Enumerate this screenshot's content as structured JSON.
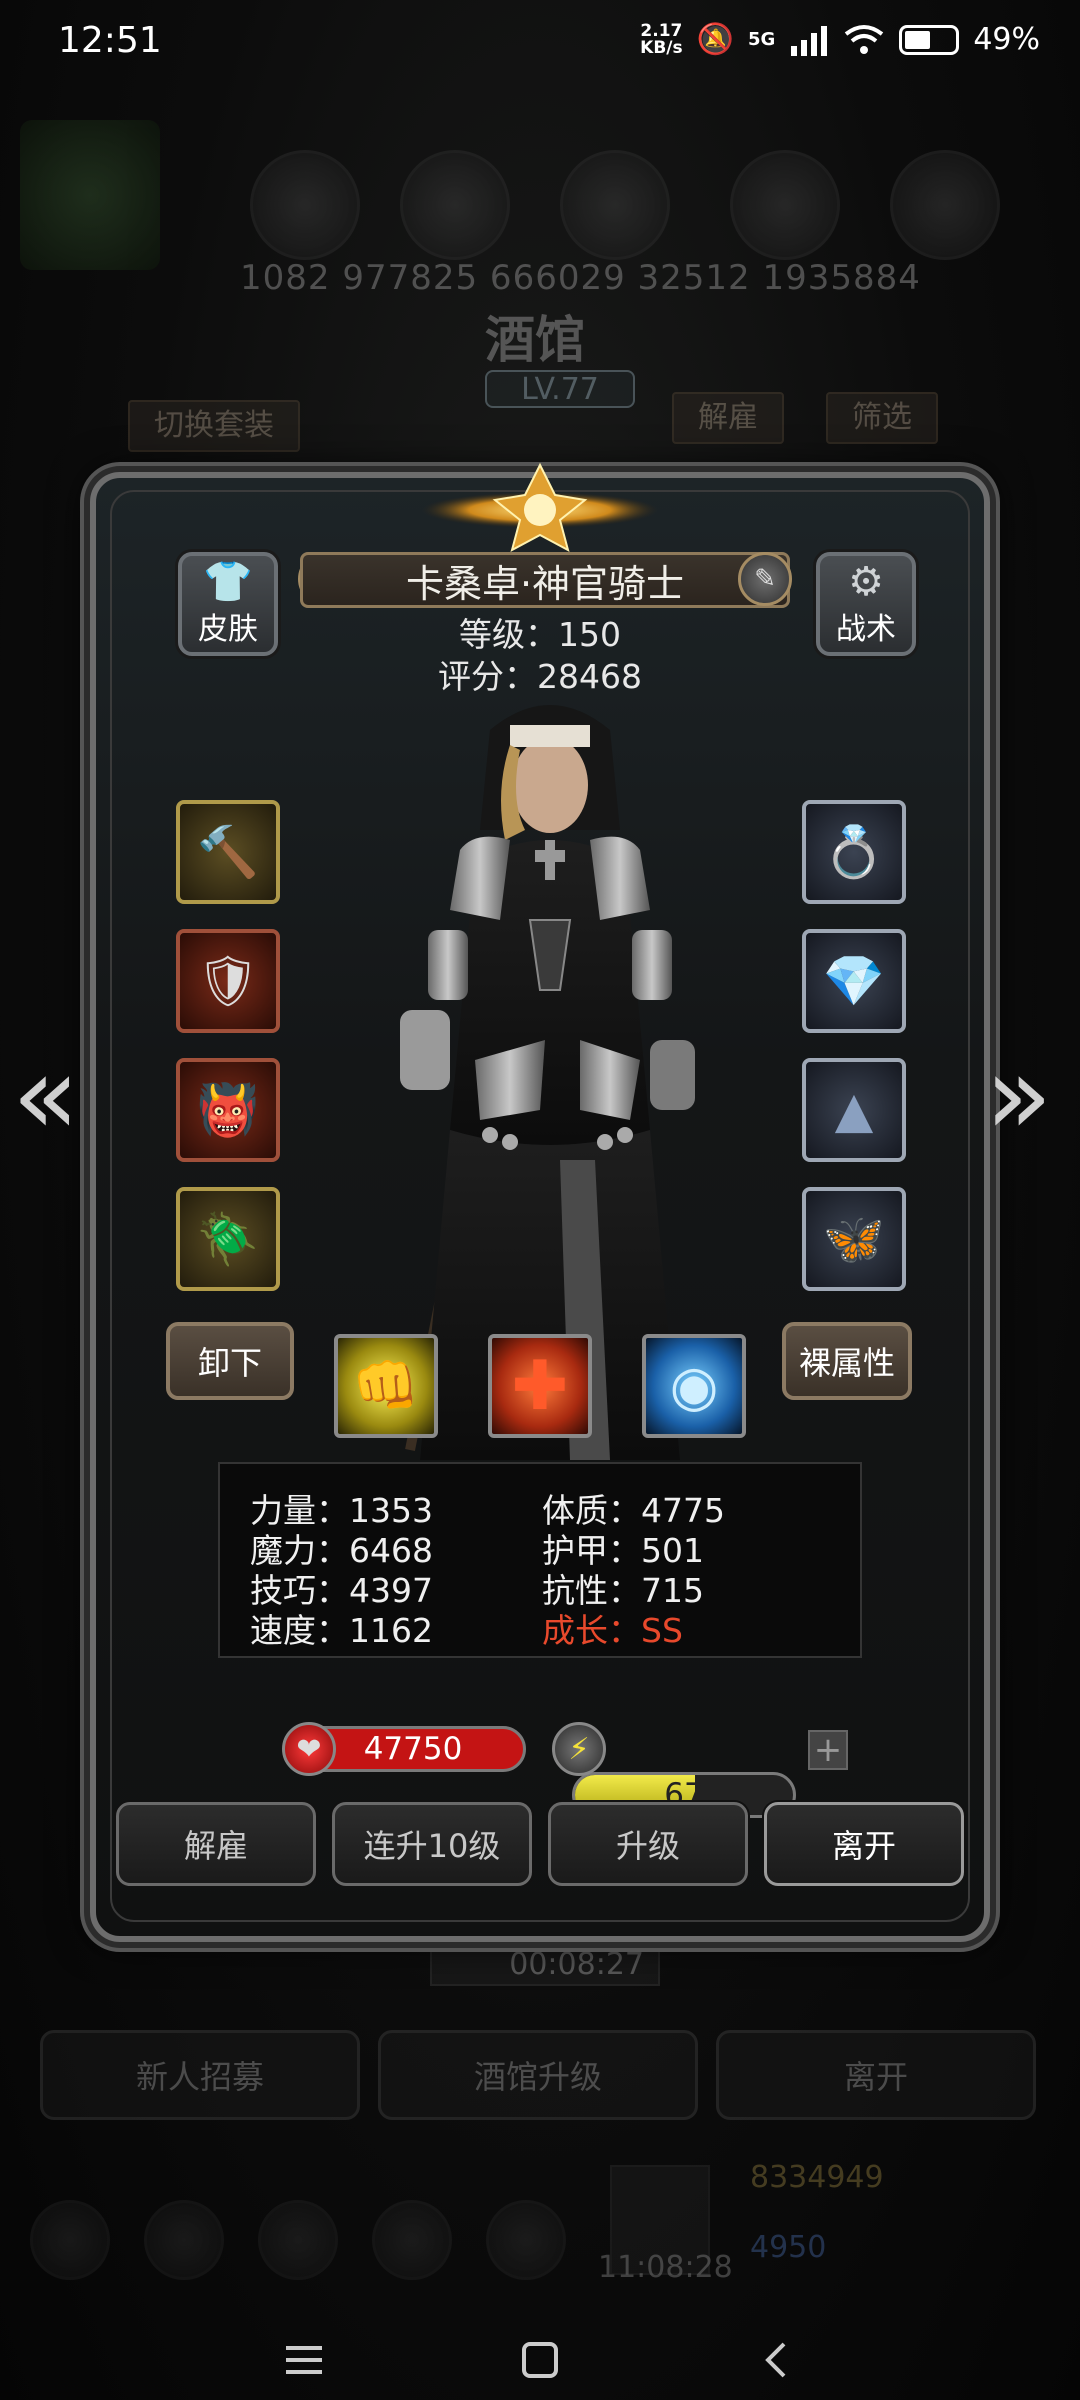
{
  "status_bar": {
    "time": "12:51",
    "speed_value": "2.17",
    "speed_unit": "KB/s",
    "network": "5G",
    "battery": "49%"
  },
  "background": {
    "resource_numbers": "1082   977825   666029   32512   1935884",
    "title": "酒馆",
    "level": "LV.77",
    "switch_outfit_tab": "切换套装",
    "dismiss_tab": "解雇",
    "filter_tab": "筛选",
    "timer": "00:08:27",
    "bottom_buttons": [
      "新人招募",
      "酒馆升级",
      "离开"
    ],
    "gold": "8334949",
    "gems": "4950",
    "bottom_timer": "11:08:28"
  },
  "hero": {
    "name": "卡桑卓·神官骑士",
    "level_label": "等级：150",
    "score_label": "评分：28468",
    "skin_button": "皮肤",
    "tactics_button": "战术",
    "unequip_button": "卸下",
    "bare_attr_button": "裸属性"
  },
  "stats": {
    "strength": "力量：1353",
    "magic": "魔力：6468",
    "skill": "技巧：4397",
    "speed": "速度：1162",
    "constitution": "体质：4775",
    "armor": "护甲：501",
    "resistance": "抗性：715",
    "growth": "成长：SS"
  },
  "bars": {
    "hp": "47750",
    "energy": "67",
    "energy_fraction": 0.55
  },
  "actions": {
    "dismiss": "解雇",
    "level_up_10": "连升10级",
    "level_up": "升级",
    "leave": "离开"
  },
  "icons": [
    "shirt-icon",
    "gear-icon",
    "medal-icon",
    "edit-icon",
    "heart-icon",
    "lightning-icon",
    "fist-icon",
    "cross-icon",
    "eye-icon"
  ],
  "colors": {
    "growth_red": "#e8492c",
    "hp_red": "#c41414",
    "energy_yellow": "#d9cf2a"
  }
}
